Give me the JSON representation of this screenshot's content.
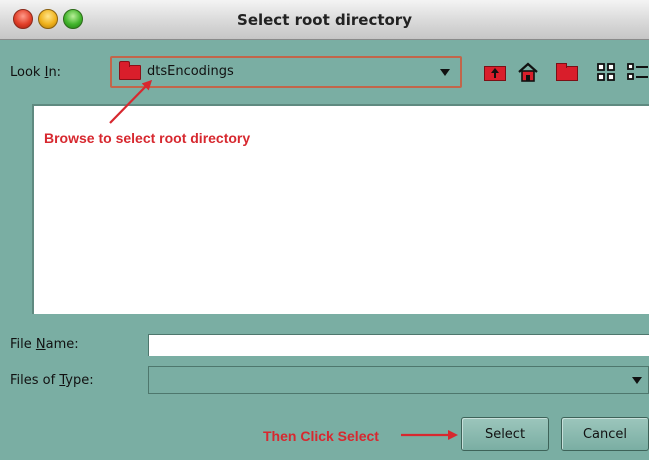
{
  "window": {
    "title": "Select root directory"
  },
  "look_in": {
    "label_pre": "Look ",
    "label_mnemonic": "I",
    "label_post": "n:",
    "value": "dtsEncodings"
  },
  "toolbar": {
    "icons": [
      "up-folder-icon",
      "home-icon",
      "new-folder-icon",
      "list-view-icon",
      "details-view-icon"
    ]
  },
  "annotations": {
    "browse": "Browse to select root directory",
    "click": "Then Click Select"
  },
  "file_name": {
    "label_pre": "File ",
    "label_mnemonic": "N",
    "label_post": "ame:",
    "value": ""
  },
  "files_of_type": {
    "label_pre": "Files of ",
    "label_mnemonic": "T",
    "label_post": "ype:",
    "value": ""
  },
  "buttons": {
    "select": "Select",
    "cancel": "Cancel"
  },
  "colors": {
    "window_bg": "#7aaea3",
    "annotation": "#d7282f",
    "folder": "#d91e2b"
  }
}
